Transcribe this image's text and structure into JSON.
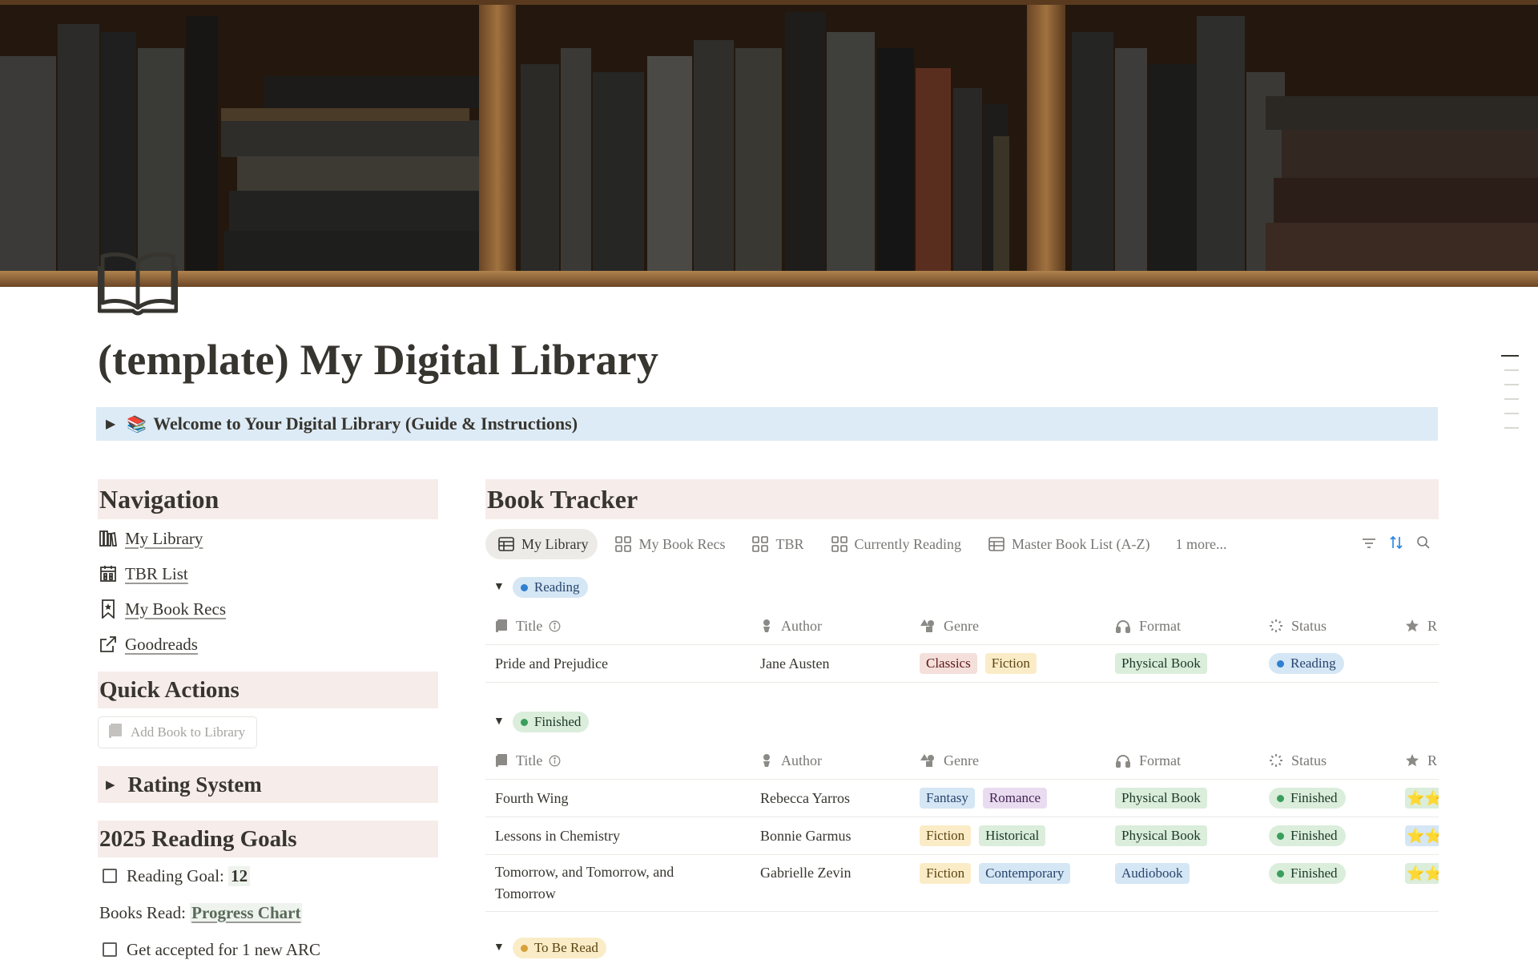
{
  "page": {
    "title": "(template) My Digital Library",
    "welcome_toggle": "Welcome to Your Digital Library (Guide & Instructions)"
  },
  "navigation": {
    "heading": "Navigation",
    "items": [
      {
        "label": "My Library",
        "icon": "bookshelf-icon"
      },
      {
        "label": "TBR List",
        "icon": "calendar-icon"
      },
      {
        "label": "My Book Recs",
        "icon": "bookmark-icon"
      },
      {
        "label": "Goodreads",
        "icon": "external-link-icon"
      }
    ]
  },
  "quick_actions": {
    "heading": "Quick Actions",
    "add_book_button": "Add Book to Library"
  },
  "rating_system": {
    "heading": "Rating System"
  },
  "goals": {
    "heading": "2025 Reading Goals",
    "reading_goal_label": "Reading Goal:",
    "reading_goal_value": "12",
    "books_read_label": "Books Read:",
    "books_read_link": "Progress Chart",
    "arc_goal": "Get accepted for 1 new ARC"
  },
  "tracker": {
    "heading": "Book Tracker",
    "tabs": [
      "My Library",
      "My Book Recs",
      "TBR",
      "Currently Reading",
      "Master Book List (A-Z)"
    ],
    "more_tabs": "1 more...",
    "columns": {
      "title": "Title",
      "author": "Author",
      "genre": "Genre",
      "format": "Format",
      "status": "Status",
      "rating": "R"
    },
    "groups": [
      {
        "label": "Reading",
        "color": "blue",
        "rows": [
          {
            "title": "Pride and Prejudice",
            "author": "Jane Austen",
            "genres": [
              "Classics",
              "Fiction"
            ],
            "format": "Physical Book",
            "status": "Reading",
            "rating": ""
          }
        ]
      },
      {
        "label": "Finished",
        "color": "green",
        "rows": [
          {
            "title": "Fourth Wing",
            "author": "Rebecca Yarros",
            "genres": [
              "Fantasy",
              "Romance"
            ],
            "format": "Physical Book",
            "status": "Finished",
            "rating": "⭐⭐"
          },
          {
            "title": "Lessons in Chemistry",
            "author": "Bonnie Garmus",
            "genres": [
              "Fiction",
              "Historical"
            ],
            "format": "Physical Book",
            "status": "Finished",
            "rating": "⭐⭐"
          },
          {
            "title": "Tomorrow, and Tomorrow, and Tomorrow",
            "author": "Gabrielle Zevin",
            "genres": [
              "Fiction",
              "Contemporary"
            ],
            "format": "Audiobook",
            "status": "Finished",
            "rating": "⭐⭐"
          }
        ]
      },
      {
        "label": "To Be Read",
        "color": "yellow",
        "rows": []
      }
    ]
  },
  "colors": {
    "section_heading_bg": "#f6ecea",
    "callout_bg": "#ddebf6",
    "tag_red": "#f4dfdb",
    "tag_yellow": "#fbecc8",
    "tag_green": "#dbeddb",
    "tag_blue": "#d5e6f5",
    "tag_purple": "#eadcf0"
  }
}
